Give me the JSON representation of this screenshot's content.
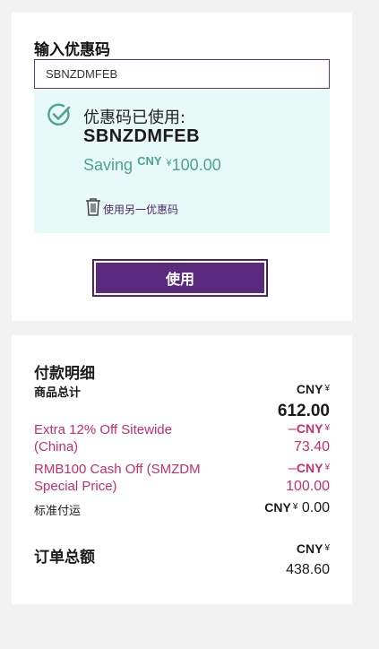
{
  "promo": {
    "title": "输入优惠码",
    "input_value": "SBNZDMFEB",
    "applied_label": "优惠码已使用:",
    "applied_code": "SBNZDMFEB",
    "saving_prefix": "Saving",
    "saving_currency": "CNY",
    "saving_symbol": "¥",
    "saving_amount": "100.00",
    "remove_label": "使用另一优惠码",
    "apply_button": "使用",
    "check_icon": "check-circle-icon",
    "trash_icon": "trash-icon"
  },
  "summary": {
    "title": "付款明细",
    "currency": "CNY",
    "symbol": "¥",
    "rows": [
      {
        "label": "商品总计",
        "sign": "",
        "amount": "612.00"
      },
      {
        "label": "Extra 12% Off Sitewide (China)",
        "sign": "–",
        "amount": "73.40"
      },
      {
        "label": "RMB100 Cash Off (SMZDM Special Price)",
        "sign": "–",
        "amount": "100.00"
      },
      {
        "label": "标准付运",
        "sign": "",
        "amount": "0.00"
      }
    ],
    "total_label": "订单总额",
    "total_amount": "438.60"
  },
  "colors": {
    "accent": "#5a2a7f",
    "success": "#4aa394",
    "success_bg": "#e8faf7",
    "discount": "#c42f6b"
  }
}
